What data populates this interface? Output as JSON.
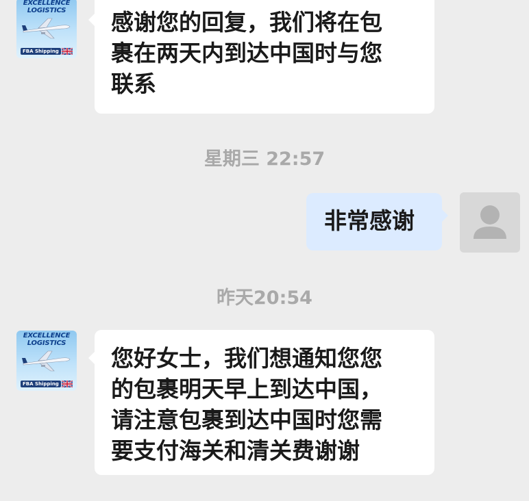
{
  "chat": {
    "brand_avatar": {
      "title_line1": "EXCELLENCE",
      "title_line2": "LOGISTICS",
      "sub_label": "FBA Shipping"
    },
    "messages": [
      {
        "direction": "incoming",
        "lines": [
          "感谢您的回复，我们将在包",
          "裹在两天内到达中国时与您",
          "联系"
        ]
      },
      {
        "type": "timestamp",
        "text": "星期三 22:57"
      },
      {
        "direction": "outgoing",
        "lines": [
          "非常感谢"
        ]
      },
      {
        "type": "timestamp",
        "text": "昨天20:54"
      },
      {
        "direction": "incoming",
        "lines": [
          "您好女士，我们想通知您您",
          "的包裹明天早上到达中国，",
          "请注意包裹到达中国时您需",
          "要支付海关和清关费谢谢"
        ]
      }
    ]
  },
  "colors": {
    "background": "#ededed",
    "incoming_bubble": "#ffffff",
    "outgoing_bubble": "#dcebff",
    "timestamp_text": "#a9a9a9",
    "message_text": "#1a1a1a"
  },
  "icons": {
    "brand_avatar": "airplane-logo-icon",
    "user_avatar": "default-person-icon",
    "flag": "uk-flag-icon"
  }
}
